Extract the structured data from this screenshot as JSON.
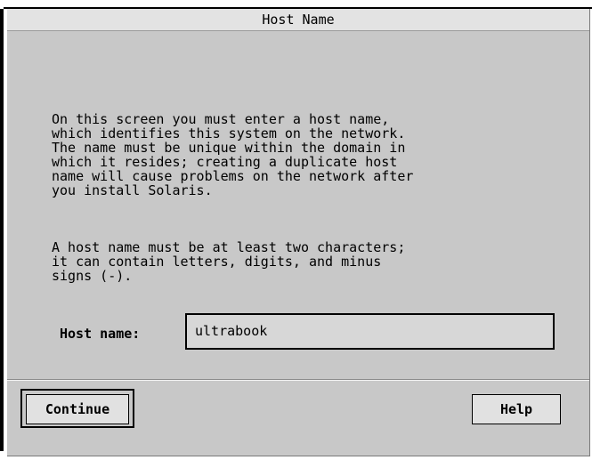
{
  "window": {
    "title": "Host Name"
  },
  "intro": {
    "paragraph1": "On this screen you must enter a host name,\nwhich identifies this system on the network.\nThe name must be unique within the domain in\nwhich it resides; creating a duplicate host\nname will cause problems on the network after\nyou install Solaris.",
    "paragraph2": "A host name must be at least two characters;\nit can contain letters, digits, and minus\nsigns (-)."
  },
  "form": {
    "host_label": "Host name:",
    "host_value": "ultrabook"
  },
  "buttons": {
    "continue_label": "Continue",
    "help_label": "Help"
  },
  "colors": {
    "dialog_background": "#c8c8c8",
    "title_background": "#e3e3e3",
    "input_background": "#d7d7d7",
    "button_background": "#e1e1e1"
  }
}
